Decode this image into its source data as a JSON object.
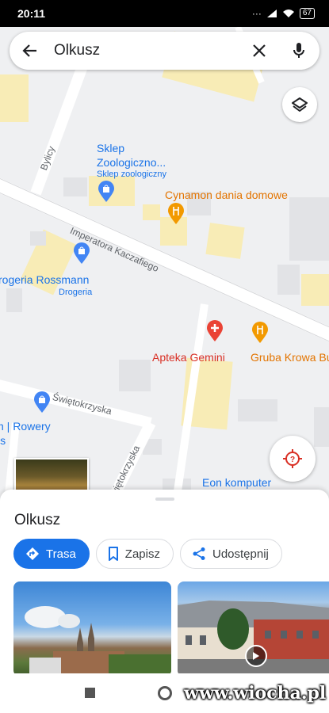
{
  "status_bar": {
    "time": "20:11",
    "battery": "67"
  },
  "search": {
    "query": "Olkusz"
  },
  "map": {
    "places": [
      {
        "name": "Sklep Zoologiczno...",
        "name_line1": "Sklep",
        "name_line2": "Zoologiczno...",
        "category": "Sklep zoologiczny",
        "color": "#1a73e8"
      },
      {
        "name": "Cynamon dania domowe",
        "color": "#e37400"
      },
      {
        "name": "Drogeria Rossmann",
        "display": "rogeria Rossmann",
        "category": "Drogeria",
        "color": "#1a73e8"
      },
      {
        "name": "Apteka Gemini",
        "color": "#d93025"
      },
      {
        "name": "Gruba Krowa Bu",
        "color": "#e37400"
      },
      {
        "name": "Eon komputer",
        "color": "#1a73e8"
      },
      {
        "name_line1": "n | Rowery",
        "name_line2": "is",
        "color": "#1a73e8"
      }
    ],
    "roads": [
      "Bylicy",
      "Imperatora Kaczafiego",
      "Świętokrzyska",
      "Świętokrzyska"
    ]
  },
  "sheet": {
    "title": "Olkusz",
    "buttons": {
      "route": "Trasa",
      "save": "Zapisz",
      "share": "Udostępnij"
    }
  },
  "watermark": "www.wiocha.pl",
  "colors": {
    "accent": "#1a73e8",
    "red": "#d93025",
    "orange": "#e37400"
  }
}
